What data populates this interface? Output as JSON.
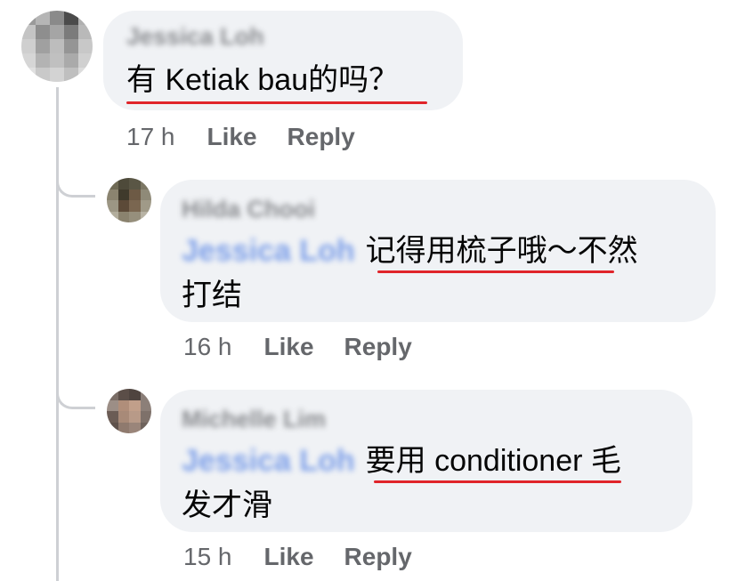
{
  "comments": [
    {
      "author": "Jessica Loh",
      "text": "有 Ketiak bau的吗？",
      "time": "17 h",
      "like_label": "Like",
      "reply_label": "Reply"
    }
  ],
  "replies": [
    {
      "author": "Hilda Chooi",
      "mention": "Jessica Loh",
      "text_line1": "记得用梳子哦～不然",
      "text_line2": "打结",
      "time": "16 h",
      "like_label": "Like",
      "reply_label": "Reply"
    },
    {
      "author": "Michelle Lim",
      "mention": "Jessica Loh",
      "text_line1": "要用 conditioner 毛",
      "text_line2": "发才滑",
      "time": "15 h",
      "like_label": "Like",
      "reply_label": "Reply"
    }
  ],
  "colors": {
    "bubble": "#f0f2f5",
    "meta_text": "#65676b",
    "underline": "#e0242a",
    "mention": "#4a7be4",
    "thread_line": "#ced0d4"
  },
  "avatar_pixels": {
    "main": [
      "#9a9a9a",
      "#b5b5b5",
      "#8a8a8a",
      "#4b4b4b",
      "#b0b0b0",
      "#c4c4c4",
      "#8e8e8e",
      "#a5a5a5",
      "#7b7b7b",
      "#b9b9b9",
      "#cfcfcf",
      "#a0a0a0",
      "#bdbdbd",
      "#959595",
      "#c8c8c8",
      "#d6d6d6",
      "#b3b3b3",
      "#c0c0c0",
      "#aaaaaa",
      "#d0d0d0",
      "#e0e0e0",
      "#c9c9c9",
      "#d3d3d3",
      "#bfbfbf",
      "#dcdcdc"
    ],
    "reply1": [
      "#6f6a55",
      "#4e4a3a",
      "#5a5645",
      "#7c7764",
      "#8b8470",
      "#3f3a2c",
      "#6d5a45",
      "#8f8a78",
      "#9c9684",
      "#5c4a38",
      "#7a6650",
      "#a09a88",
      "#b2ad9c",
      "#8a826e",
      "#968f7c",
      "#b8b3a4"
    ],
    "reply2": [
      "#7a6d66",
      "#5b4e48",
      "#4f443f",
      "#8a7e78",
      "#9c8e86",
      "#b08e7a",
      "#c19f8a",
      "#8c7f78",
      "#6b5c55",
      "#a88a78",
      "#b89a88",
      "#7e716a",
      "#5e514b",
      "#8f7a6e",
      "#9a857a",
      "#6e625c"
    ]
  }
}
